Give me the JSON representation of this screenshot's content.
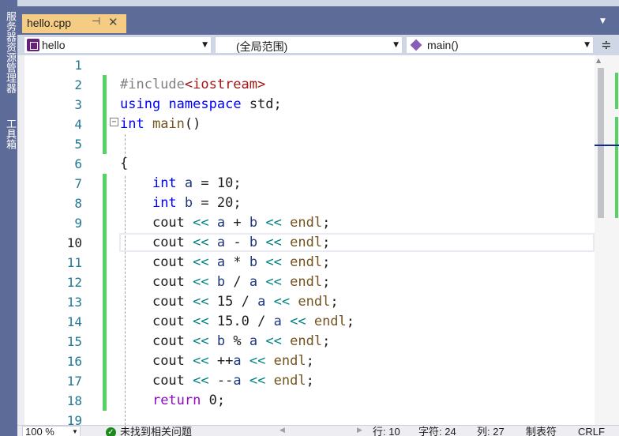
{
  "side_tabs": [
    "服务器资源管理器",
    "工具箱"
  ],
  "tab": {
    "filename": "hello.cpp",
    "pin_icon": "pin-icon",
    "close_icon": "close-icon"
  },
  "navbar": {
    "project": "hello",
    "scope": "(全局范围)",
    "member": "main()"
  },
  "lines": [
    {
      "n": "1"
    },
    {
      "n": "2"
    },
    {
      "n": "3"
    },
    {
      "n": "4"
    },
    {
      "n": "5"
    },
    {
      "n": "6"
    },
    {
      "n": "7"
    },
    {
      "n": "8"
    },
    {
      "n": "9"
    },
    {
      "n": "10"
    },
    {
      "n": "11"
    },
    {
      "n": "12"
    },
    {
      "n": "13"
    },
    {
      "n": "14"
    },
    {
      "n": "15"
    },
    {
      "n": "16"
    },
    {
      "n": "17"
    },
    {
      "n": "18"
    },
    {
      "n": "19"
    }
  ],
  "code": {
    "l2a": "#include",
    "l2b": "<iostream>",
    "l3a": "using",
    "l3b": "namespace",
    "l3c": "std;",
    "l4a": "int",
    "l4b": "main",
    "l4c": "()",
    "l6": "{",
    "l7a": "int",
    "l7b": "a",
    "l7c": " = 10;",
    "l8a": "int",
    "l8b": "b",
    "l8c": " = 20;",
    "cout": "cout",
    "shl": "<<",
    "endl": "endl",
    "a": "a",
    "b": "b",
    "plus": "+",
    "minus": "-",
    "mul": "*",
    "div": "/",
    "mod": "%",
    "n15": "15",
    "n150": "15.0",
    "inc": "++",
    "dec": "--",
    "semi": ";",
    "ret": "return",
    "zero": "0"
  },
  "status": {
    "zoom": "100 %",
    "issues": "未找到相关问题",
    "line": "行: 10",
    "char": "字符: 24",
    "col": "列: 27",
    "tabs": "制表符",
    "eol": "CRLF"
  }
}
